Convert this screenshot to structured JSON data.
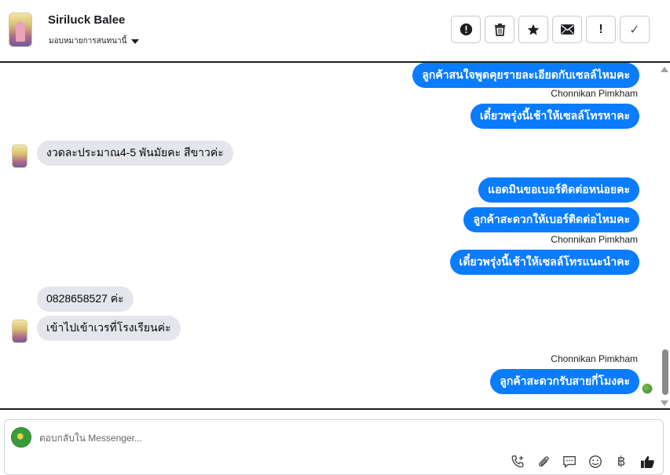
{
  "header": {
    "name": "Siriluck Balee",
    "assign_label": "มอบหมายการสนทนานี้",
    "actions": [
      {
        "name": "report-button",
        "icon": "alert-circle-icon"
      },
      {
        "name": "delete-button",
        "icon": "trash-icon"
      },
      {
        "name": "star-button",
        "icon": "star-icon"
      },
      {
        "name": "mail-button",
        "icon": "envelope-icon"
      },
      {
        "name": "spam-button",
        "icon": "exclamation-icon",
        "glyph": "!"
      },
      {
        "name": "done-button",
        "icon": "check-icon",
        "glyph": "✓"
      }
    ]
  },
  "messages": [
    {
      "dir": "out",
      "text": "ลูกค้าสนใจพูดคุยรายละเอียดกับเซลล์ไหมคะ"
    },
    {
      "dir": "sender",
      "text": "Chonnikan Pimkham"
    },
    {
      "dir": "out",
      "text": "เดี๋ยวพรุ่งนี้เช้าให้เซลล์โทรหาคะ"
    },
    {
      "dir": "in",
      "text": "งวดละประมาณ4-5 พันมัยคะ สีขาวค่ะ"
    },
    {
      "dir": "out",
      "text": "แอดมินขอเบอร์ติดต่อหน่อยคะ"
    },
    {
      "dir": "out",
      "text": "ลูกค้าสะดวกให้เบอร์ติดต่อไหมคะ"
    },
    {
      "dir": "sender",
      "text": "Chonnikan Pimkham"
    },
    {
      "dir": "out",
      "text": "เดี๋ยวพรุ่งนี้เช้าให้เซลล์โทรแนะนำคะ"
    },
    {
      "dir": "in",
      "text": "0828658527 ค่ะ"
    },
    {
      "dir": "in",
      "text": "เข้าไปเข้าเวรที่โรงเรียนค่ะ"
    },
    {
      "dir": "sender",
      "text": "Chonnikan Pimkham"
    },
    {
      "dir": "out",
      "text": "ลูกค้าสะดวกรับสายกี่โมงคะ"
    }
  ],
  "composer": {
    "placeholder": "ตอบกลับใน Messenger...",
    "tools": [
      "call-icon",
      "attachment-icon",
      "saved-reply-icon",
      "emoji-icon",
      "baht-icon",
      "like-icon"
    ],
    "baht_glyph": "฿"
  },
  "colors": {
    "accent": "#0a7cff",
    "incoming": "#e4e6eb"
  }
}
